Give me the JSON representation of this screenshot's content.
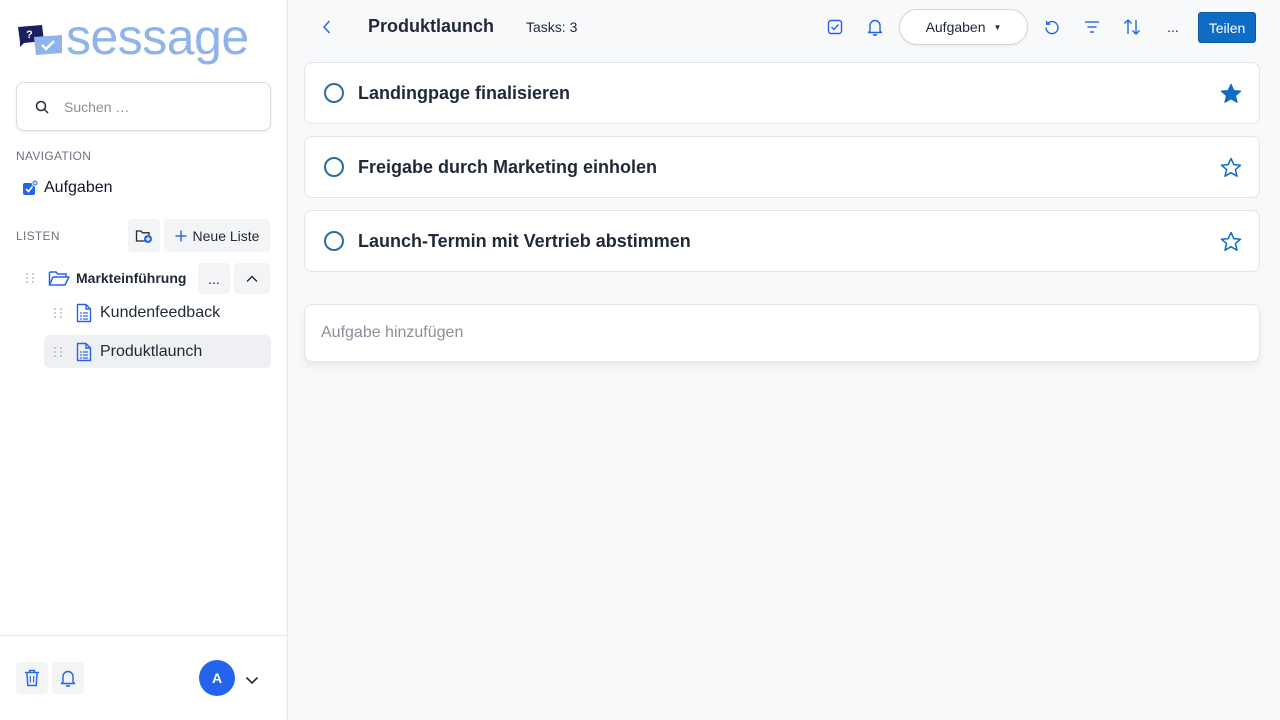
{
  "app": {
    "logo_text": "sessage"
  },
  "sidebar": {
    "search_placeholder": "Suchen …",
    "navigation_label": "NAVIGATION",
    "nav_items": [
      {
        "label": "Aufgaben",
        "icon": "task-add-icon"
      }
    ],
    "lists_label": "LISTEN",
    "new_list_label": "Neue Liste",
    "folder": {
      "label": "Markteinführung",
      "more_label": "..."
    },
    "lists": [
      {
        "label": "Kundenfeedback",
        "selected": false
      },
      {
        "label": "Produktlaunch",
        "selected": true
      }
    ],
    "user": {
      "avatar_initial": "A"
    }
  },
  "header": {
    "title": "Produktlaunch",
    "task_count": "Tasks: 3",
    "view_dropdown": "Aufgaben",
    "more_label": "...",
    "share_label": "Teilen"
  },
  "tasks": [
    {
      "title": "Landingpage finalisieren",
      "starred": true
    },
    {
      "title": "Freigabe durch Marketing einholen",
      "starred": false
    },
    {
      "title": "Launch-Termin mit Vertrieb abstimmen",
      "starred": false
    }
  ],
  "add_task_placeholder": "Aufgabe hinzufügen",
  "colors": {
    "accent": "#0e6cc4",
    "avatar": "#2563eb",
    "logo": "#8fb4ea",
    "checkbox": "#2a6f97"
  }
}
